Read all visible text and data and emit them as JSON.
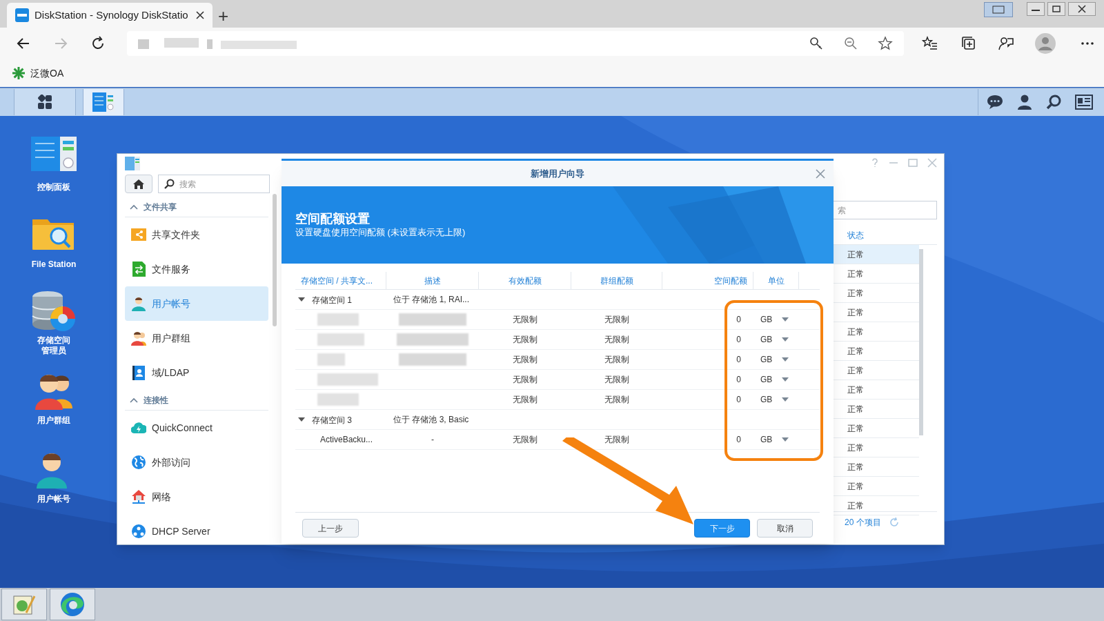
{
  "browser": {
    "tab_title": "DiskStation - Synology DiskStatio",
    "new_tab": "+",
    "bookmark": "泛微OA"
  },
  "desktop_icons": [
    {
      "kind": "control-panel",
      "lines": [
        "控制面板"
      ]
    },
    {
      "kind": "file-station",
      "lines": [
        "File Station"
      ]
    },
    {
      "kind": "storage",
      "lines": [
        "存储空间",
        "管理员"
      ]
    },
    {
      "kind": "group",
      "lines": [
        "用户群组"
      ]
    },
    {
      "kind": "user",
      "lines": [
        "用户帐号"
      ]
    }
  ],
  "control_panel": {
    "search_placeholder": "搜索",
    "sections": [
      {
        "title": "文件共享",
        "expanded": true,
        "items": [
          {
            "kind": "shared-folder",
            "label": "共享文件夹",
            "selected": false
          },
          {
            "kind": "file-service",
            "label": "文件服务",
            "selected": false
          },
          {
            "kind": "user",
            "label": "用户帐号",
            "selected": true
          },
          {
            "kind": "group",
            "label": "用户群组",
            "selected": false
          },
          {
            "kind": "ldap",
            "label": "域/LDAP",
            "selected": false
          }
        ]
      },
      {
        "title": "连接性",
        "expanded": true,
        "items": [
          {
            "kind": "cloud",
            "label": "QuickConnect",
            "selected": false
          },
          {
            "kind": "globe",
            "label": "外部访问",
            "selected": false
          },
          {
            "kind": "network",
            "label": "网络",
            "selected": false
          },
          {
            "kind": "dhcp",
            "label": "DHCP Server",
            "selected": false
          }
        ]
      }
    ],
    "list_search_placeholder": "索",
    "status_header": "状态",
    "status_rows": [
      {
        "status": "正常",
        "selected": true
      },
      {
        "status": "正常",
        "selected": false
      },
      {
        "status": "正常",
        "selected": false
      },
      {
        "status": "正常",
        "selected": false
      },
      {
        "status": "正常",
        "selected": false
      },
      {
        "status": "正常",
        "selected": false
      },
      {
        "status": "正常",
        "selected": false
      },
      {
        "status": "正常",
        "selected": false
      },
      {
        "status": "正常",
        "selected": false
      },
      {
        "status": "正常",
        "selected": false
      },
      {
        "status": "正常",
        "selected": false
      },
      {
        "status": "正常",
        "selected": false
      },
      {
        "status": "正常",
        "selected": false
      },
      {
        "status": "正常",
        "selected": false
      }
    ],
    "footer": "20 个项目"
  },
  "dialog": {
    "title": "新增用户向导",
    "banner_title": "空间配额设置",
    "banner_subtitle": "设置硬盘使用空间配额 (未设置表示无上限)",
    "columns": [
      "存储空间 / 共享文...",
      "描述",
      "有效配额",
      "群组配额",
      "空间配额",
      "单位"
    ],
    "groups": [
      {
        "name": "存储空间 1",
        "desc": "位于 存储池 1, RAI...",
        "expanded": true,
        "rows": [
          {
            "effective": "无限制",
            "group": "无限制",
            "quota": "0",
            "unit": "GB"
          },
          {
            "effective": "无限制",
            "group": "无限制",
            "quota": "0",
            "unit": "GB"
          },
          {
            "effective": "无限制",
            "group": "无限制",
            "quota": "0",
            "unit": "GB"
          },
          {
            "effective": "无限制",
            "group": "无限制",
            "quota": "0",
            "unit": "GB"
          },
          {
            "effective": "无限制",
            "group": "无限制",
            "quota": "0",
            "unit": "GB"
          }
        ]
      },
      {
        "name": "存储空间 3",
        "desc": "位于 存储池 3, Basic",
        "expanded": true,
        "rows": [
          {
            "name": "ActiveBacku...",
            "desc": "-",
            "effective": "无限制",
            "group": "无限制",
            "quota": "0",
            "unit": "GB"
          }
        ]
      }
    ],
    "back": "上一步",
    "next": "下一步",
    "cancel": "取消"
  }
}
